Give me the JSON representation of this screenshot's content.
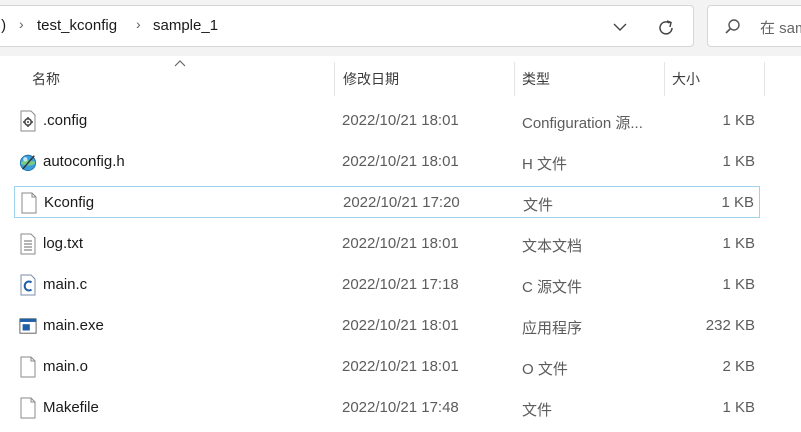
{
  "address": {
    "crumbs": [
      ":)",
      "test_kconfig",
      "sample_1"
    ],
    "sep": "›"
  },
  "search": {
    "placeholder": "在 sam"
  },
  "columns": {
    "name": "名称",
    "date": "修改日期",
    "type": "类型",
    "size": "大小"
  },
  "files": [
    {
      "name": ".config",
      "date": "2022/10/21 18:01",
      "type": "Configuration 源...",
      "size": "1 KB",
      "icon": "gear-file-icon"
    },
    {
      "name": "autoconfig.h",
      "date": "2022/10/21 18:01",
      "type": "H 文件",
      "size": "1 KB",
      "icon": "header-file-icon"
    },
    {
      "name": "Kconfig",
      "date": "2022/10/21 17:20",
      "type": "文件",
      "size": "1 KB",
      "icon": "blank-file-icon",
      "selected": true
    },
    {
      "name": "log.txt",
      "date": "2022/10/21 18:01",
      "type": "文本文档",
      "size": "1 KB",
      "icon": "text-file-icon"
    },
    {
      "name": "main.c",
      "date": "2022/10/21 17:18",
      "type": "C 源文件",
      "size": "1 KB",
      "icon": "c-source-icon"
    },
    {
      "name": "main.exe",
      "date": "2022/10/21 18:01",
      "type": "应用程序",
      "size": "232 KB",
      "icon": "exe-file-icon"
    },
    {
      "name": "main.o",
      "date": "2022/10/21 18:01",
      "type": "O 文件",
      "size": "2 KB",
      "icon": "blank-file-icon"
    },
    {
      "name": "Makefile",
      "date": "2022/10/21 17:48",
      "type": "文件",
      "size": "1 KB",
      "icon": "blank-file-icon"
    }
  ],
  "colors": {
    "selection_border": "#9fd2ec",
    "toolbar_bg": "#f3f3f3"
  }
}
